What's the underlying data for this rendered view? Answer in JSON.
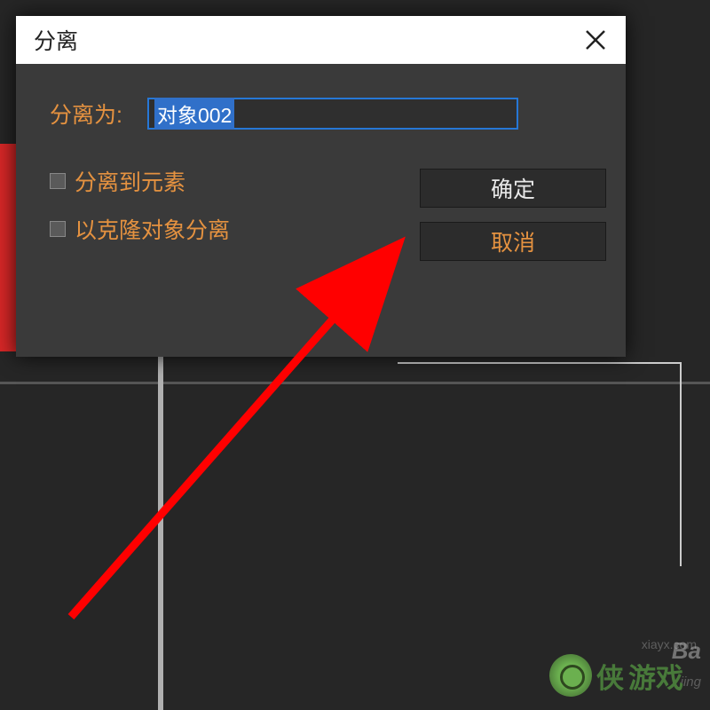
{
  "dialog": {
    "title": "分离",
    "input_label": "分离为:",
    "input_value": "对象002",
    "checkbox1_label": "分离到元素",
    "checkbox2_label": "以克隆对象分离",
    "confirm_label": "确定",
    "cancel_label": "取消"
  },
  "watermarks": {
    "site": "xiayx.com",
    "game": "游戏",
    "game_brand": "侠",
    "baidu": "Ba",
    "jingyan": "jing"
  }
}
